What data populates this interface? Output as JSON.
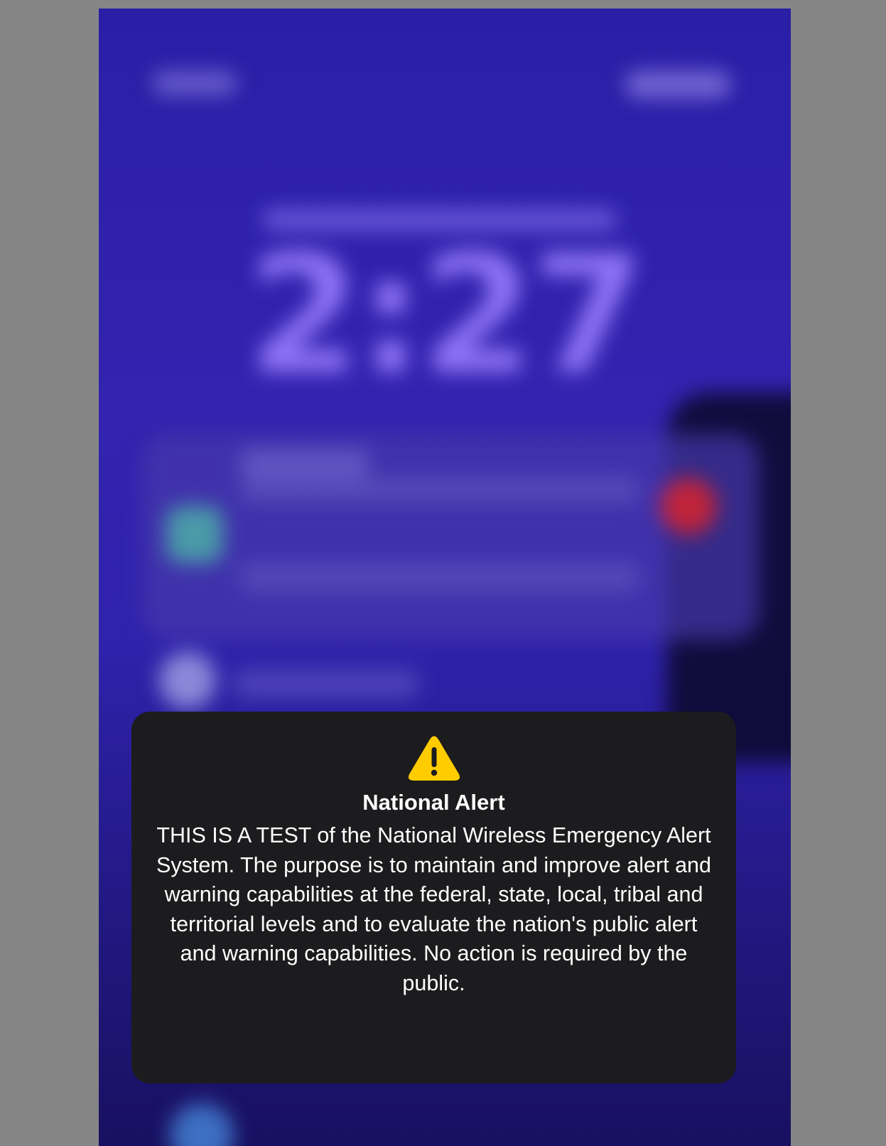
{
  "lock_screen": {
    "time": "2:27"
  },
  "alert": {
    "icon": "warning-icon",
    "title": "National Alert",
    "message": "THIS IS A TEST of the National Wireless Emergency Alert System. The purpose is to maintain and improve alert and warning capabilities at the federal, state, local, tribal and territorial levels and to evaluate the nation's public alert and warning capabilities. No action is required by the public.",
    "icon_color": "#ffcc00"
  },
  "colors": {
    "backdrop": "#858585",
    "wallpaper": "#3323b0",
    "card_background": "#1c1c1e",
    "text": "#ffffff"
  }
}
